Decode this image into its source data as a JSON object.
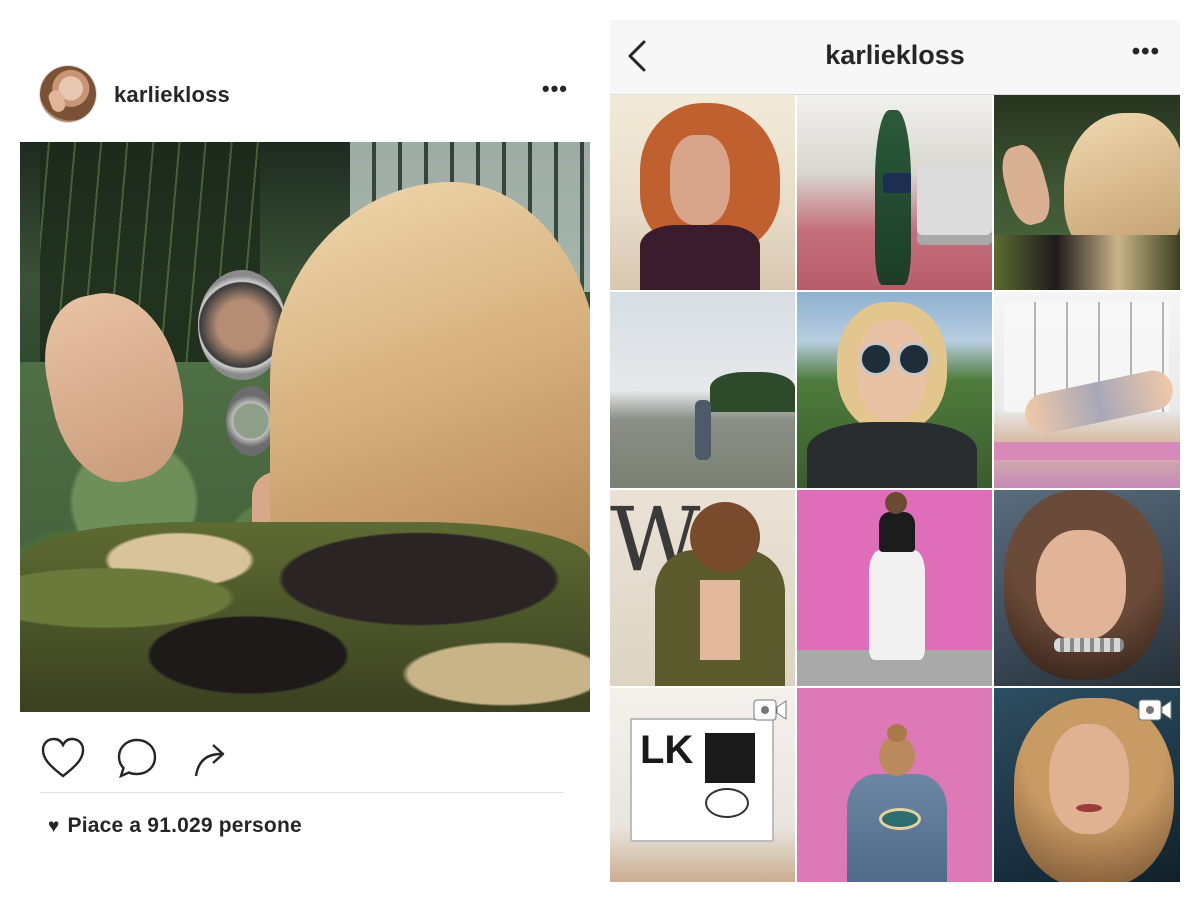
{
  "post": {
    "username": "karliekloss",
    "more_label": "•••",
    "likes_text": "Piace a 91.029 persone",
    "likes_icon": "heart-filled-icon",
    "actions": [
      "like-icon",
      "comment-icon",
      "share-icon"
    ]
  },
  "profile": {
    "title": "karliekloss",
    "more_label": "•••",
    "back_icon": "chevron-left-icon",
    "grid": [
      {
        "id": 1,
        "video": false
      },
      {
        "id": 2,
        "video": false
      },
      {
        "id": 3,
        "video": false
      },
      {
        "id": 4,
        "video": false
      },
      {
        "id": 5,
        "video": false
      },
      {
        "id": 6,
        "video": false
      },
      {
        "id": 7,
        "video": false
      },
      {
        "id": 8,
        "video": false
      },
      {
        "id": 9,
        "video": false
      },
      {
        "id": 10,
        "video": true
      },
      {
        "id": 11,
        "video": false
      },
      {
        "id": 12,
        "video": true
      }
    ]
  },
  "colors": {
    "text": "#262626",
    "topbar_bg": "#f7f7f7",
    "divider": "#e3e3e3"
  }
}
